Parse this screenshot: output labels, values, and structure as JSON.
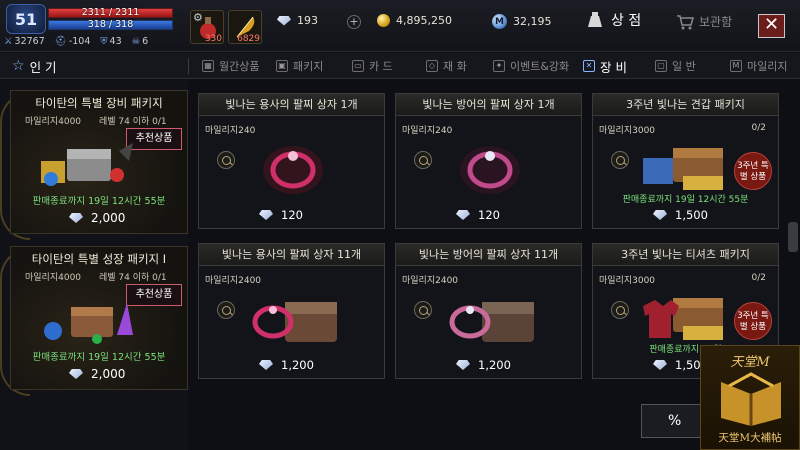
{
  "player": {
    "level": "51",
    "hp": "2311 / 2311",
    "mp": "318 / 318",
    "stats": [
      {
        "icon": "combat-power-icon",
        "value": "32767"
      },
      {
        "icon": "helmet-icon",
        "value": "-104"
      },
      {
        "icon": "armor-icon",
        "value": "43"
      },
      {
        "icon": "skull-icon",
        "value": "6"
      }
    ]
  },
  "slots": [
    {
      "icon": "potion-icon",
      "count": "330"
    },
    {
      "icon": "feather-icon",
      "count": "6829"
    }
  ],
  "currency": {
    "diamond": "193",
    "adena": "4,895,250",
    "mileage": "32,195"
  },
  "header": {
    "shop_label": "상 점",
    "storage_label": "보관함",
    "close_label": "✕"
  },
  "tabs": [
    {
      "label": "인 기",
      "active": true
    },
    {
      "label": "월간상품"
    },
    {
      "label": "패키지"
    },
    {
      "label": "카 드"
    },
    {
      "label": "재 화"
    },
    {
      "label": "이벤트&강화"
    },
    {
      "label": "장 비",
      "active": true
    },
    {
      "label": "일 반"
    },
    {
      "label": "마일리지"
    }
  ],
  "left_packages": [
    {
      "title": "타이탄의 특별 장비 패키지",
      "mileage": "마일리지4000",
      "level": "레벨 74 이하 0/1",
      "badge": "추천상품",
      "time": "판매종료까지 19일 12시간 55분",
      "price": "2,000"
    },
    {
      "title": "타이탄의 특별 성장 패키지 I",
      "mileage": "마일리지4000",
      "level": "레벨 74 이하 0/1",
      "badge": "추천상품",
      "time": "판매종료까지 19일 12시간 55분",
      "price": "2,000"
    }
  ],
  "cards": [
    {
      "title": "빛나는 용사의 팔찌 상자 1개",
      "mileage": "마일리지240",
      "count": "",
      "price": "120",
      "time": "",
      "badge": ""
    },
    {
      "title": "빛나는 방어의 팔찌 상자 1개",
      "mileage": "마일리지240",
      "count": "",
      "price": "120",
      "time": "",
      "badge": ""
    },
    {
      "title": "3주년 빛나는 견갑 패키지",
      "mileage": "마일리지3000",
      "count": "0/2",
      "price": "1,500",
      "time": "판매종료까지 19일 12시간 55분",
      "badge": "3주년 특별 상품"
    },
    {
      "title": "빛나는 용사의 팔찌 상자 11개",
      "mileage": "마일리지2400",
      "count": "",
      "price": "1,200",
      "time": "",
      "badge": ""
    },
    {
      "title": "빛나는 방어의 팔찌 상자 11개",
      "mileage": "마일리지2400",
      "count": "",
      "price": "1,200",
      "time": "",
      "badge": ""
    },
    {
      "title": "3주년 빛나는 티셔츠 패키지",
      "mileage": "마일리지3000",
      "count": "0/2",
      "price": "1,500",
      "time": "판매종료까지 19일",
      "badge": "3주년 특별 상품"
    }
  ],
  "bottom": {
    "percent_label": "%"
  },
  "watermark": {
    "top": "天堂M",
    "bottom": "天堂M大補帖"
  }
}
